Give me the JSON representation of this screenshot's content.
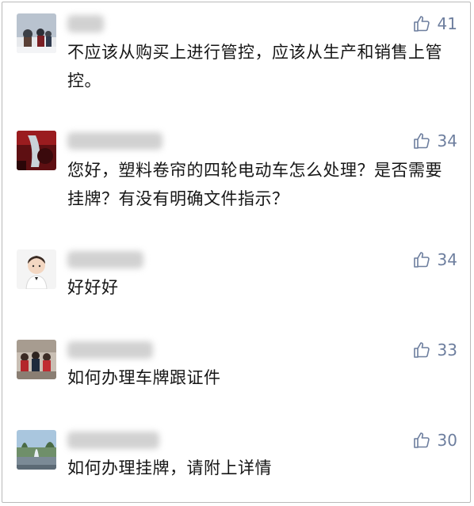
{
  "comments": [
    {
      "likes": "41",
      "text": "不应该从购买上进行管控，应该从生产和销售上管控。"
    },
    {
      "likes": "34",
      "text": "您好，塑料卷帘的四轮电动车怎么处理？是否需要挂牌？有没有明确文件指示？"
    },
    {
      "likes": "34",
      "text": "好好好"
    },
    {
      "likes": "33",
      "text": "如何办理车牌跟证件"
    },
    {
      "likes": "30",
      "text": "如何办理挂牌，请附上详情"
    }
  ],
  "icons": {
    "like": "thumbs-up-icon"
  },
  "colors": {
    "like_text": "#6d7e9e",
    "comment_text": "#161616",
    "border": "#b9b9b9"
  }
}
